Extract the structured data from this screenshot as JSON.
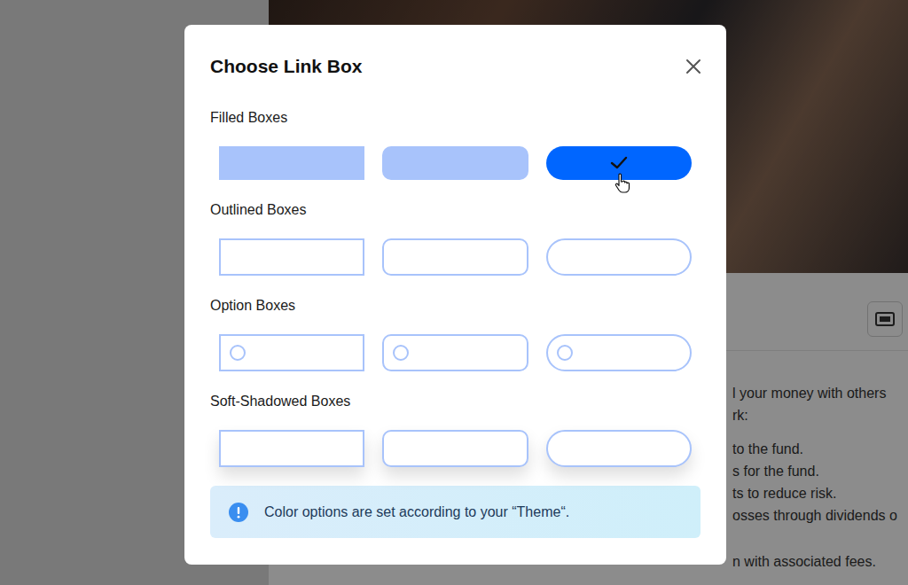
{
  "background": {
    "groups": [
      [
        "l your money with others",
        "rk:"
      ],
      [
        "to the fund.",
        "s for the fund.",
        "ts to reduce risk.",
        "osses through dividends o"
      ],
      [
        "n with associated fees."
      ]
    ]
  },
  "dialog": {
    "title": "Choose Link Box",
    "sections": [
      {
        "label": "Filled Boxes",
        "kind": "filled",
        "options": [
          {
            "kind": "square",
            "selected": false
          },
          {
            "kind": "rounded",
            "selected": false
          },
          {
            "kind": "pill",
            "selected": true
          }
        ]
      },
      {
        "label": "Outlined Boxes",
        "kind": "outlined",
        "options": [
          {
            "kind": "square",
            "selected": false
          },
          {
            "kind": "rounded",
            "selected": false
          },
          {
            "kind": "pill",
            "selected": false
          }
        ]
      },
      {
        "label": "Option Boxes",
        "kind": "option",
        "options": [
          {
            "kind": "square",
            "selected": false
          },
          {
            "kind": "rounded",
            "selected": false
          },
          {
            "kind": "pill",
            "selected": false
          }
        ]
      },
      {
        "label": "Soft-Shadowed Boxes",
        "kind": "shadowed",
        "options": [
          {
            "kind": "square",
            "selected": false
          },
          {
            "kind": "rounded",
            "selected": false
          },
          {
            "kind": "pill",
            "selected": false
          }
        ]
      }
    ],
    "info": "Color options are set according to your “Theme“."
  }
}
